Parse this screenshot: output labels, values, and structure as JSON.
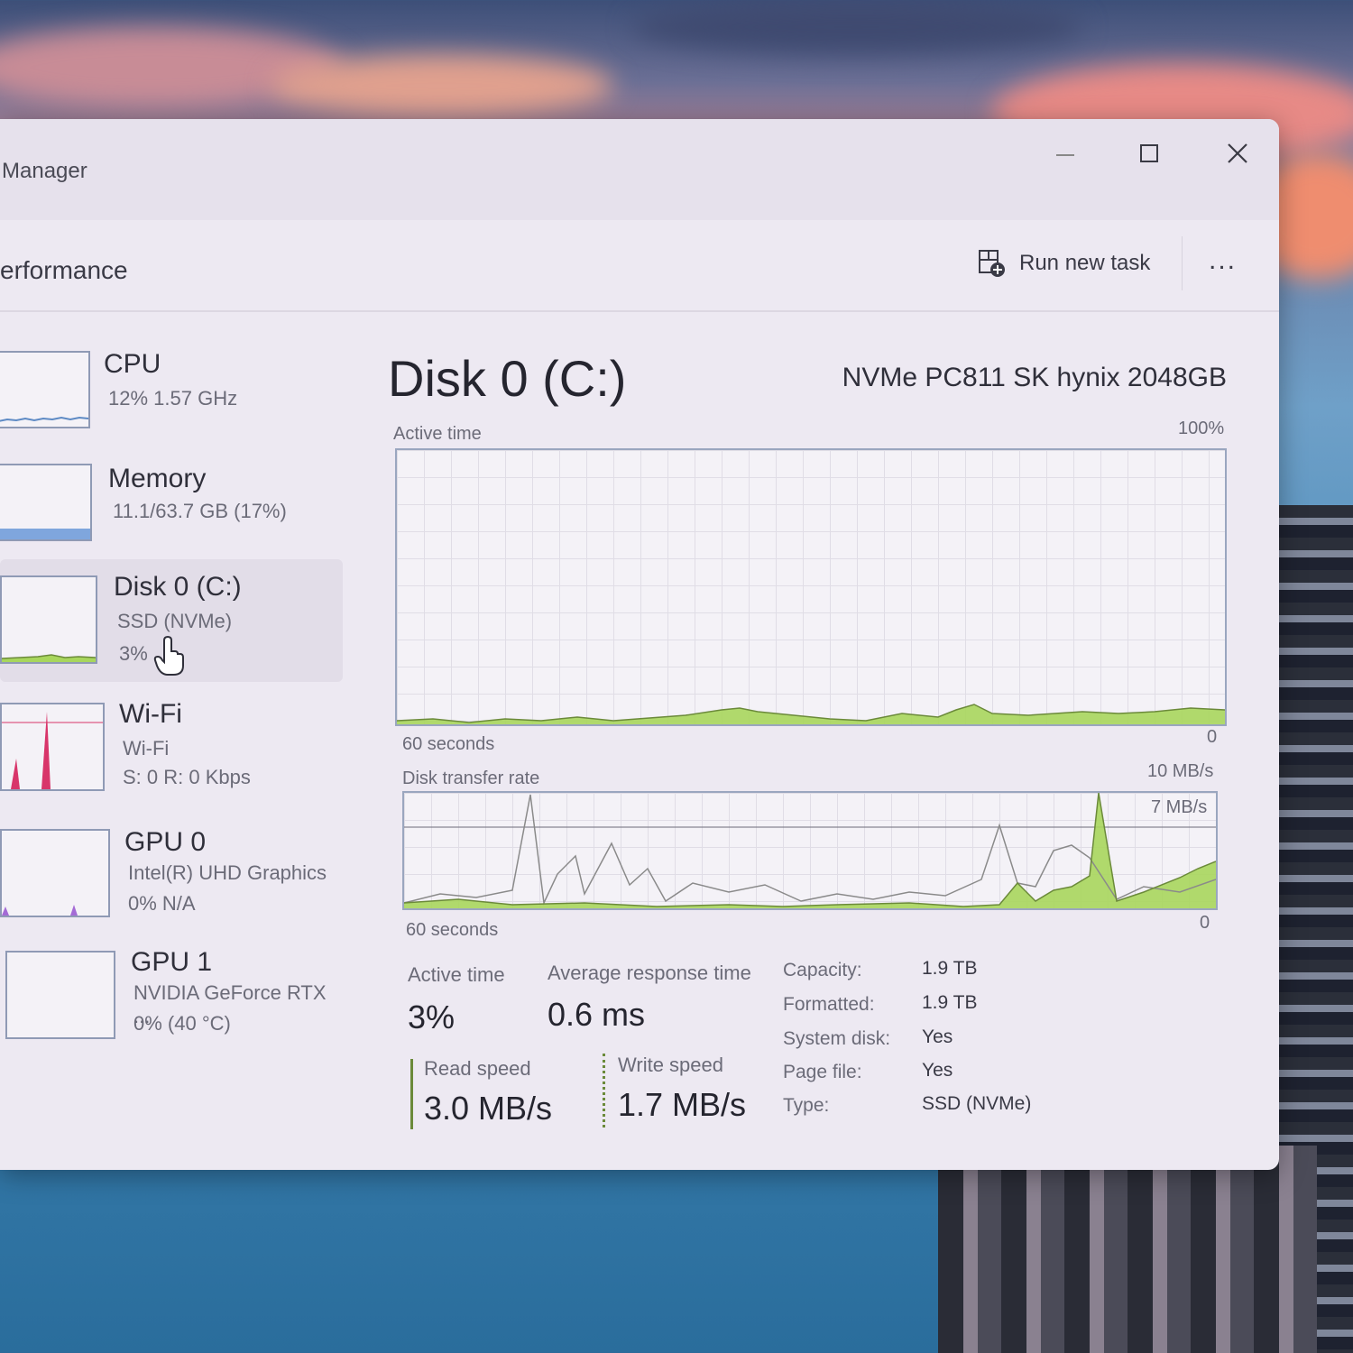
{
  "window": {
    "title": "Manager"
  },
  "header": {
    "title": "erformance",
    "run_new_task": "Run new task",
    "more": "..."
  },
  "sidebar": {
    "items": [
      {
        "name": "CPU",
        "sub1": "12%  1.57 GHz"
      },
      {
        "name": "Memory",
        "sub1": "11.1/63.7 GB (17%)"
      },
      {
        "name": "Disk 0 (C:)",
        "sub1": "SSD (NVMe)",
        "sub2": "3%"
      },
      {
        "name": "Wi-Fi",
        "sub1": "Wi-Fi",
        "sub2": "S: 0  R: 0 Kbps"
      },
      {
        "name": "GPU 0",
        "sub1": "Intel(R) UHD Graphics",
        "sub2": "0%  N/A"
      },
      {
        "name": "GPU 1",
        "sub1": "NVIDIA GeForce RTX ...",
        "sub2": "0% (40 °C)"
      }
    ]
  },
  "main": {
    "title": "Disk 0 (C:)",
    "model": "NVMe PC811 SK hynix 2048GB",
    "active_graph": {
      "label": "Active time",
      "max": "100%",
      "time": "60 seconds",
      "min": "0"
    },
    "transfer_graph": {
      "label": "Disk transfer rate",
      "max": "10 MB/s",
      "marker": "7 MB/s",
      "time": "60 seconds",
      "min": "0"
    },
    "stats": {
      "active_time_label": "Active time",
      "active_time": "3%",
      "avg_response_label": "Average response time",
      "avg_response": "0.6 ms",
      "read_label": "Read speed",
      "read": "3.0 MB/s",
      "write_label": "Write speed",
      "write": "1.7 MB/s"
    },
    "props": [
      {
        "label": "Capacity:",
        "value": "1.9 TB"
      },
      {
        "label": "Formatted:",
        "value": "1.9 TB"
      },
      {
        "label": "System disk:",
        "value": "Yes"
      },
      {
        "label": "Page file:",
        "value": "Yes"
      },
      {
        "label": "Type:",
        "value": "SSD (NVMe)"
      }
    ]
  },
  "colors": {
    "disk_green": "#a8d65c",
    "wifi_red": "#d8356a",
    "memory_blue": "#7fa6dd",
    "line_gray": "#8a8a8a"
  }
}
